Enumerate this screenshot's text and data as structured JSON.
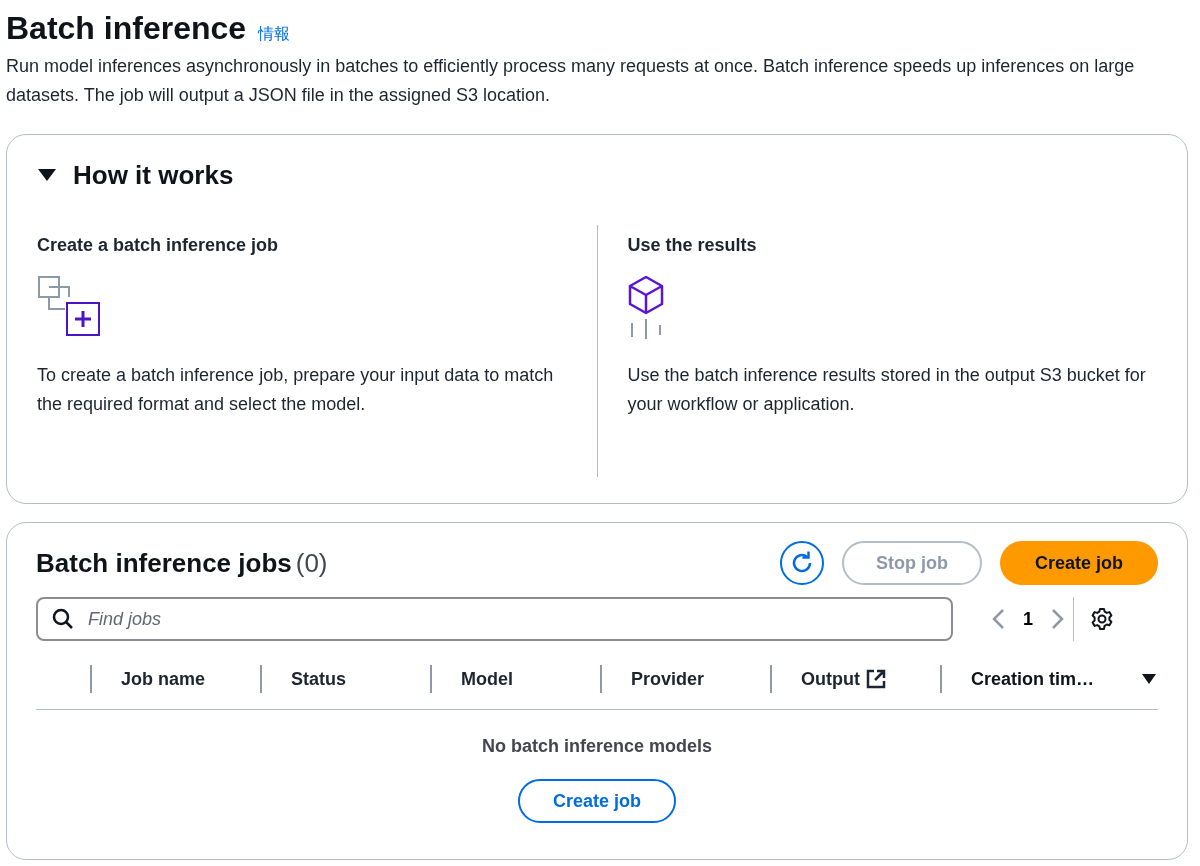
{
  "header": {
    "title": "Batch inference",
    "info_link": "情報",
    "description": "Run model inferences asynchronously in batches to efficiently process many requests at once. Batch inference speeds up inferences on large datasets. The job will output a JSON file in the assigned S3 location."
  },
  "how_it_works": {
    "title": "How it works",
    "expanded": true,
    "steps": [
      {
        "kind": "create",
        "title": "Create a batch inference job",
        "text": "To create a batch inference job, prepare your input data to match the required format and select the model."
      },
      {
        "kind": "results",
        "title": "Use the results",
        "text": "Use the batch inference results stored in the output S3 bucket for your workflow or application."
      }
    ]
  },
  "jobs": {
    "title": "Batch inference jobs",
    "count": "(0)",
    "stop_button": {
      "label": "Stop job",
      "disabled": true
    },
    "create_button": "Create job",
    "search": {
      "placeholder": "Find jobs"
    },
    "page": "1",
    "columns": [
      {
        "label": "Job name",
        "kind": "plain"
      },
      {
        "label": "Status",
        "kind": "plain"
      },
      {
        "label": "Model",
        "kind": "plain"
      },
      {
        "label": "Provider",
        "kind": "plain"
      },
      {
        "label": "Output",
        "kind": "external"
      },
      {
        "label": "Creation tim…",
        "kind": "sorted"
      }
    ],
    "empty_text": "No batch inference models",
    "empty_button": "Create job"
  }
}
